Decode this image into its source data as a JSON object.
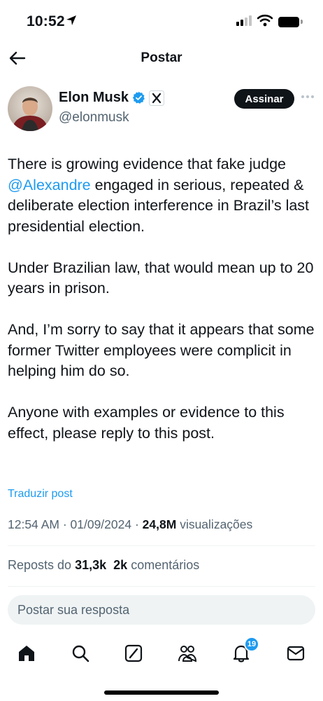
{
  "status_bar": {
    "time": "10:52",
    "icons": [
      "location-arrow-icon",
      "cellular-signal-icon",
      "wifi-icon",
      "battery-icon"
    ]
  },
  "header": {
    "title": "Postar",
    "back_icon": "arrow-left-icon"
  },
  "author": {
    "name": "Elon Musk",
    "handle": "@elonmusk",
    "verified_icon": "verified-badge-icon",
    "affiliation_icon": "x-logo-icon",
    "subscribe_label": "Assinar",
    "more_icon": "more-dots-icon"
  },
  "post": {
    "p1_before": "There is growing evidence that fake judge ",
    "p1_mention": "@Alexandre",
    "p1_after": " engaged in serious, repeated & deliberate election interference in Brazil’s last presidential election.",
    "p2": "Under Brazilian law, that would mean up to 20 years in prison.",
    "p3": "And, I’m sorry to say that it appears that some former Twitter employees were complicit in helping him do so.",
    "p4": "Anyone with examples or evidence to this effect, please reply to this post.",
    "translate_label": "Traduzir post",
    "time": "12:54 AM",
    "date": "01/09/2024",
    "views_count": "24,8M",
    "views_label": "visualizações"
  },
  "stats": {
    "reposts_label": "Reposts do",
    "reposts_count": "31,3k",
    "comments_count": "2k",
    "comments_label": "comentários"
  },
  "reply": {
    "placeholder": "Postar sua resposta"
  },
  "nav": {
    "items": [
      "home-icon",
      "search-icon",
      "compose-icon",
      "communities-icon",
      "notifications-icon",
      "messages-icon"
    ],
    "notifications_badge": "19"
  },
  "colors": {
    "accent": "#1d9bf0",
    "text": "#0f1419",
    "muted": "#536471",
    "divider": "#eff3f4",
    "reply_bg": "#eff3f4"
  }
}
